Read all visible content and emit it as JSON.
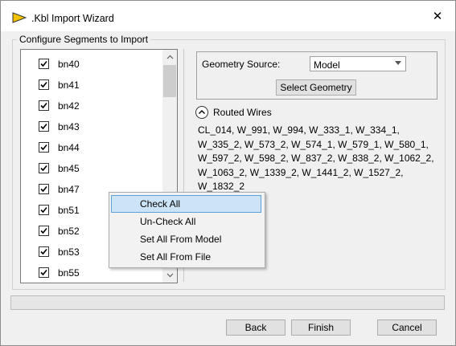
{
  "window": {
    "title": ".Kbl Import Wizard",
    "close_glyph": "✕",
    "icon": "labview-icon"
  },
  "group": {
    "label": "Configure Segments to Import"
  },
  "segments": [
    {
      "label": "bn40",
      "checked": true
    },
    {
      "label": "bn41",
      "checked": true
    },
    {
      "label": "bn42",
      "checked": true
    },
    {
      "label": "bn43",
      "checked": true
    },
    {
      "label": "bn44",
      "checked": true
    },
    {
      "label": "bn45",
      "checked": true
    },
    {
      "label": "bn47",
      "checked": true
    },
    {
      "label": "bn51",
      "checked": true
    },
    {
      "label": "bn52",
      "checked": true
    },
    {
      "label": "bn53",
      "checked": true
    },
    {
      "label": "bn55",
      "checked": true
    }
  ],
  "geometry": {
    "label": "Geometry Source:",
    "value": "Model",
    "button": "Select Geometry"
  },
  "routed": {
    "label": "Routed Wires",
    "wires": "CL_014, W_991, W_994, W_333_1, W_334_1, W_335_2, W_573_2, W_574_1, W_579_1, W_580_1, W_597_2, W_598_2, W_837_2, W_838_2, W_1062_2, W_1063_2, W_1339_2, W_1441_2, W_1527_2, W_1832_2"
  },
  "context_menu": {
    "items": [
      "Check All",
      "Un-Check All",
      "Set All From Model",
      "Set All From File"
    ],
    "highlighted": "Check All"
  },
  "buttons": {
    "back": "Back",
    "finish": "Finish",
    "cancel": "Cancel"
  },
  "colors": {
    "highlight": "#cce4f7",
    "highlight_border": "#5ea1d8",
    "panel": "#f0f0f0"
  }
}
